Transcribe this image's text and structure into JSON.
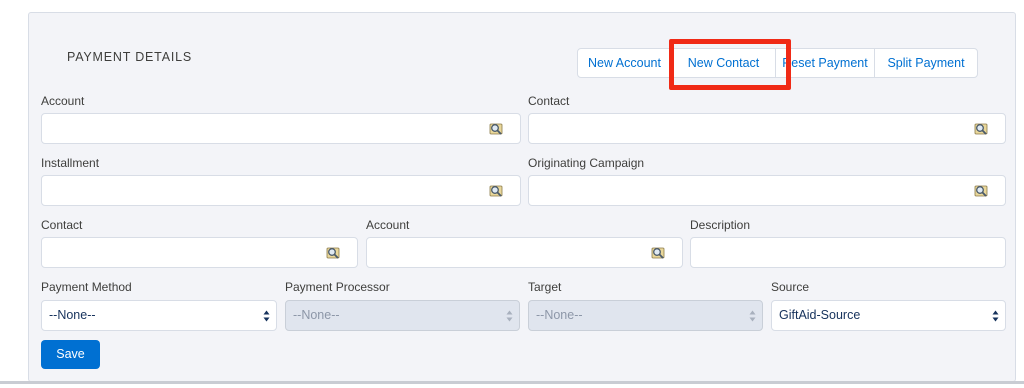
{
  "section": {
    "title": "PAYMENT DETAILS"
  },
  "toolbar": {
    "new_account": "New Account",
    "new_contact": "New Contact",
    "reset_payment": "Reset Payment",
    "split_payment": "Split Payment",
    "highlighted": "New Contact",
    "highlight_color": "#f02a16"
  },
  "fields": {
    "account_label": "Account",
    "contact_label": "Contact",
    "installment_label": "Installment",
    "originating_campaign_label": "Originating Campaign",
    "contact2_label": "Contact",
    "account2_label": "Account",
    "description_label": "Description",
    "payment_method_label": "Payment Method",
    "payment_processor_label": "Payment Processor",
    "target_label": "Target",
    "source_label": "Source"
  },
  "selects": {
    "payment_method_value": "--None--",
    "payment_processor_value": "--None--",
    "target_value": "--None--",
    "source_value": "GiftAid-Source"
  },
  "actions": {
    "save_label": "Save"
  },
  "icons": {
    "lookup": "lookup-icon",
    "caret": "select-caret-icon"
  },
  "colors": {
    "accent": "#0070d2",
    "panel_bg": "#f3f4f8",
    "disabled_bg": "#e0e5ee"
  }
}
